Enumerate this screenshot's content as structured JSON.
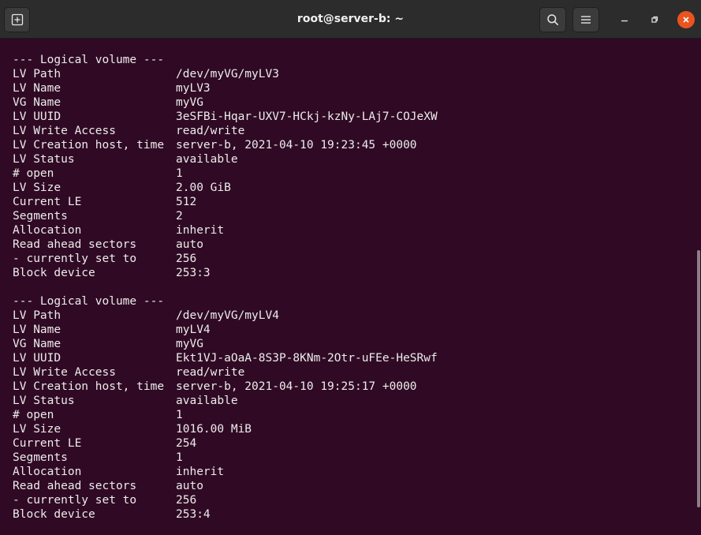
{
  "window": {
    "title": "root@server-b: ~",
    "icons": {
      "new_tab": "new-tab-icon",
      "search": "search-icon",
      "menu": "hamburger-menu-icon",
      "minimize": "minimize-icon",
      "maximize": "maximize-icon",
      "close": "close-icon"
    },
    "accent_close": "#e95420",
    "terminal_bg": "#300a24"
  },
  "volumes": [
    {
      "header": "--- Logical volume ---",
      "rows": [
        {
          "key": "LV Path",
          "value": "/dev/myVG/myLV3"
        },
        {
          "key": "LV Name",
          "value": "myLV3"
        },
        {
          "key": "VG Name",
          "value": "myVG"
        },
        {
          "key": "LV UUID",
          "value": "3eSFBi-Hqar-UXV7-HCkj-kzNy-LAj7-COJeXW"
        },
        {
          "key": "LV Write Access",
          "value": "read/write"
        },
        {
          "key": "LV Creation host, time",
          "value": "server-b, 2021-04-10 19:23:45 +0000"
        },
        {
          "key": "LV Status",
          "value": "available"
        },
        {
          "key": "# open",
          "value": "1"
        },
        {
          "key": "LV Size",
          "value": "2.00 GiB"
        },
        {
          "key": "Current LE",
          "value": "512"
        },
        {
          "key": "Segments",
          "value": "2"
        },
        {
          "key": "Allocation",
          "value": "inherit"
        },
        {
          "key": "Read ahead sectors",
          "value": "auto"
        },
        {
          "key": "- currently set to",
          "value": "256"
        },
        {
          "key": "Block device",
          "value": "253:3"
        }
      ]
    },
    {
      "header": "--- Logical volume ---",
      "rows": [
        {
          "key": "LV Path",
          "value": "/dev/myVG/myLV4"
        },
        {
          "key": "LV Name",
          "value": "myLV4"
        },
        {
          "key": "VG Name",
          "value": "myVG"
        },
        {
          "key": "LV UUID",
          "value": "Ekt1VJ-aOaA-8S3P-8KNm-2Otr-uFEe-HeSRwf"
        },
        {
          "key": "LV Write Access",
          "value": "read/write"
        },
        {
          "key": "LV Creation host, time",
          "value": "server-b, 2021-04-10 19:25:17 +0000"
        },
        {
          "key": "LV Status",
          "value": "available"
        },
        {
          "key": "# open",
          "value": "1"
        },
        {
          "key": "LV Size",
          "value": "1016.00 MiB"
        },
        {
          "key": "Current LE",
          "value": "254"
        },
        {
          "key": "Segments",
          "value": "1"
        },
        {
          "key": "Allocation",
          "value": "inherit"
        },
        {
          "key": "Read ahead sectors",
          "value": "auto"
        },
        {
          "key": "- currently set to",
          "value": "256"
        },
        {
          "key": "Block device",
          "value": "253:4"
        }
      ]
    }
  ]
}
